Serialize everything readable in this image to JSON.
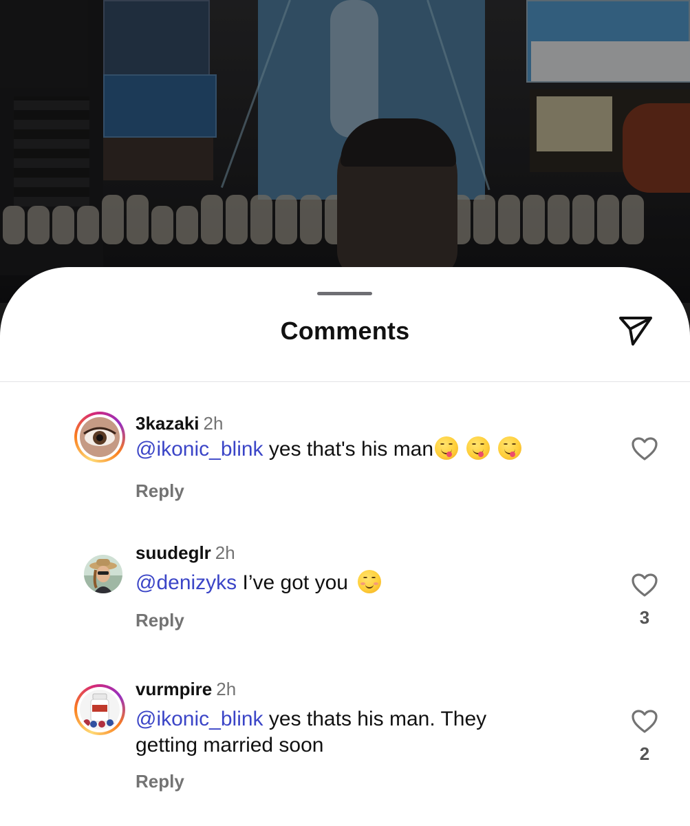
{
  "sheet": {
    "title": "Comments",
    "share_icon": "paper-plane-icon"
  },
  "comments": [
    {
      "username": "3kazaki",
      "time": "2h",
      "mention": "@ikonic_blink",
      "text": " yes that's his man",
      "emojis": [
        "yum-face",
        "yum-face",
        "yum-face"
      ],
      "reply_label": "Reply",
      "like_count": "",
      "avatar": "eye-closeup",
      "story_ring": true
    },
    {
      "username": "suudeglr",
      "time": "2h",
      "mention": "@denizyks",
      "text": " I’ve got you ",
      "emojis": [
        "relieved-face"
      ],
      "reply_label": "Reply",
      "like_count": "3",
      "avatar": "woman-in-hat",
      "story_ring": false
    },
    {
      "username": "vurmpire",
      "time": "2h",
      "mention": "@ikonic_blink",
      "text": " yes thats his man. They getting married soon",
      "emojis": [],
      "reply_label": "Reply",
      "like_count": "2",
      "avatar": "supplement-bottle",
      "story_ring": true
    }
  ],
  "colors": {
    "mention": "#3b45c7",
    "secondary_text": "#737373",
    "story_ring": [
      "#feda75",
      "#fa7e1e",
      "#d62976",
      "#962fbf"
    ]
  }
}
